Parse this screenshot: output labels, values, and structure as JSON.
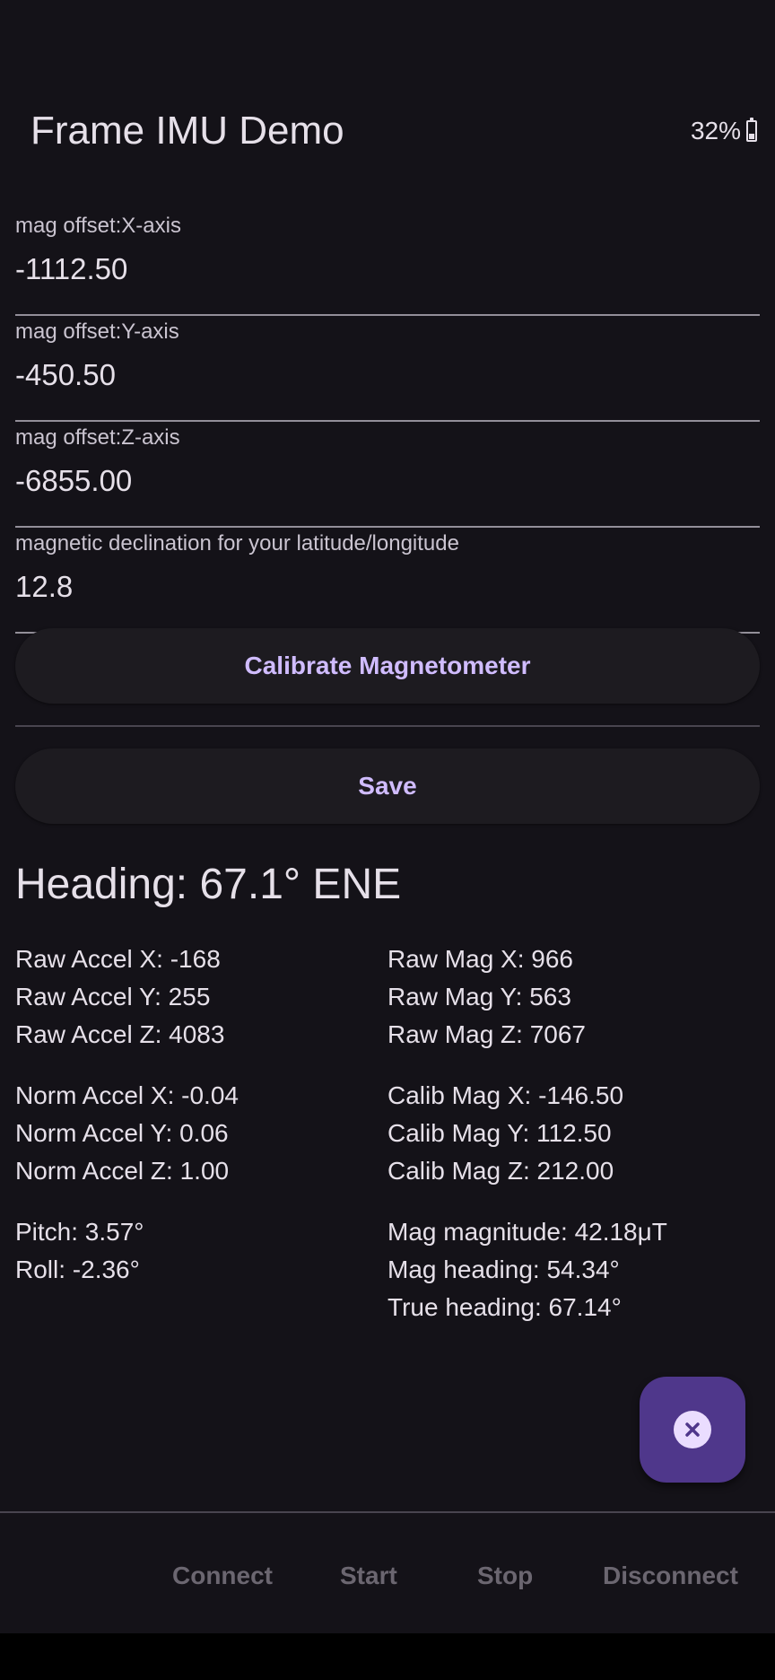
{
  "app": {
    "title": "Frame IMU Demo"
  },
  "status": {
    "battery_text": "32%",
    "battery_level": 0.32
  },
  "fields": {
    "mag_x": {
      "label": "mag offset:X-axis",
      "value": "-1112.50"
    },
    "mag_y": {
      "label": "mag offset:Y-axis",
      "value": "-450.50"
    },
    "mag_z": {
      "label": "mag offset:Z-axis",
      "value": "-6855.00"
    },
    "declination": {
      "label": "magnetic declination for your latitude/longitude",
      "value": "12.8"
    }
  },
  "buttons": {
    "calibrate": "Calibrate Magnetometer",
    "save": "Save"
  },
  "heading": "Heading: 67.1° ENE",
  "readings": {
    "left": {
      "raw_accel_x": "Raw Accel X: -168",
      "raw_accel_y": "Raw Accel Y: 255",
      "raw_accel_z": "Raw Accel Z: 4083",
      "norm_accel_x": "Norm Accel X: -0.04",
      "norm_accel_y": "Norm Accel Y: 0.06",
      "norm_accel_z": "Norm Accel Z: 1.00",
      "pitch": "Pitch: 3.57°",
      "roll": "Roll: -2.36°"
    },
    "right": {
      "raw_mag_x": "Raw Mag X: 966",
      "raw_mag_y": "Raw Mag Y: 563",
      "raw_mag_z": "Raw Mag Z: 7067",
      "calib_mag_x": "Calib Mag X: -146.50",
      "calib_mag_y": "Calib Mag Y: 112.50",
      "calib_mag_z": "Calib Mag Z: 212.00",
      "mag_magnitude": "Mag magnitude: 42.18μT",
      "mag_heading": "Mag heading: 54.34°",
      "true_heading": "True heading: 67.14°"
    }
  },
  "fab": {
    "icon": "close-icon"
  },
  "bottom_bar": {
    "connect": "Connect",
    "start": "Start",
    "stop": "Stop",
    "disconnect": "Disconnect"
  },
  "colors": {
    "background": "#141218",
    "accent": "#d0bcff",
    "fab": "#4f378b",
    "disabled": "#6b6670"
  }
}
